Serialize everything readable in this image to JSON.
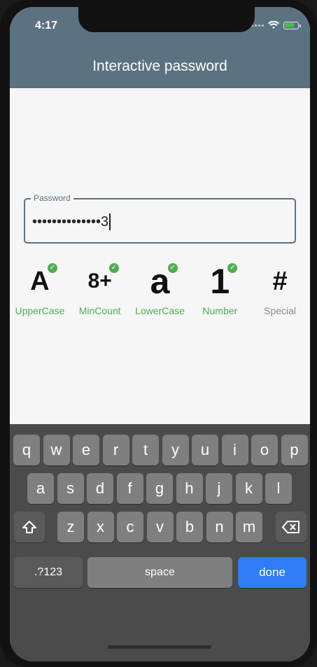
{
  "status": {
    "time": "4:17"
  },
  "header": {
    "title": "Interactive password"
  },
  "password": {
    "label": "Password",
    "masked_value": "••••••••••••••3"
  },
  "criteria": [
    {
      "symbol": "A",
      "label": "UpperCase",
      "met": true
    },
    {
      "symbol": "8+",
      "label": "MinCount",
      "met": true
    },
    {
      "symbol": "a",
      "label": "LowerCase",
      "met": true
    },
    {
      "symbol": "1",
      "label": "Number",
      "met": true
    },
    {
      "symbol": "#",
      "label": "Special",
      "met": false
    }
  ],
  "keyboard": {
    "row1": [
      "q",
      "w",
      "e",
      "r",
      "t",
      "y",
      "u",
      "i",
      "o",
      "p"
    ],
    "row2": [
      "a",
      "s",
      "d",
      "f",
      "g",
      "h",
      "j",
      "k",
      "l"
    ],
    "row3": [
      "z",
      "x",
      "c",
      "v",
      "b",
      "n",
      "m"
    ],
    "numbers_label": ".?123",
    "space_label": "space",
    "done_label": "done"
  },
  "colors": {
    "header": "#5b7280",
    "check": "#4caf50",
    "done": "#2f7cf6"
  },
  "icons": {
    "shift": "shift-icon",
    "backspace": "backspace-icon",
    "check": "checkmark-icon"
  }
}
